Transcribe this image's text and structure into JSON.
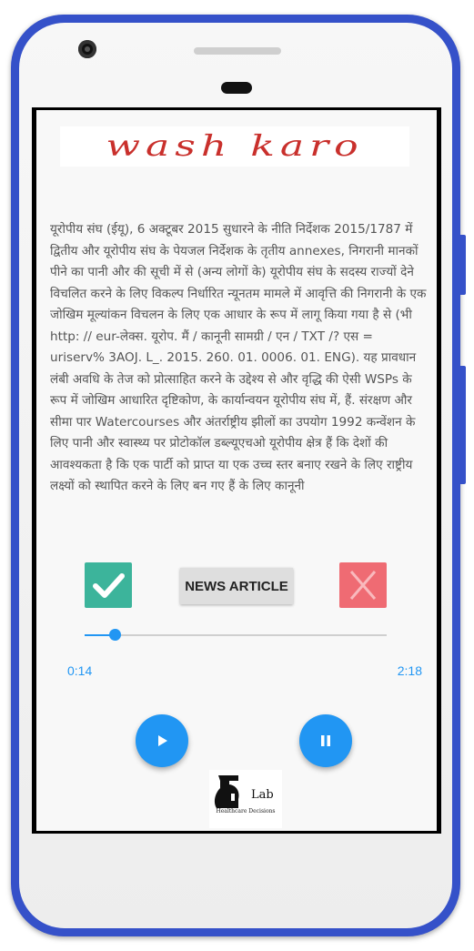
{
  "app": {
    "logo_text": "wash karo"
  },
  "article": {
    "text": "यूरोपीय संघ (ईयू), 6 अक्टूबर 2015 सुधारने के नीति निर्देशक 2015/1787 में द्वितीय और यूरोपीय संघ के पेयजल निर्देशक के तृतीय annexes, निगरानी मानकों पीने का पानी और की सूची में से (अन्य लोगों के) यूरोपीय संघ के सदस्य राज्यों देने विचलित करने के लिए विकल्प निर्धारित न्यूनतम मामले में आवृत्ति की निगरानी के एक जोखिम मूल्यांकन विचलन के लिए एक आधार के रूप में लागू किया गया है से (भी http: // eur-लेक्स. यूरोप. मैं / कानूनी सामग्री / एन / TXT /? एस = uriserv% 3AOJ. L_. 2015. 260. 01. 0006. 01. ENG). यह प्रावधान लंबी अवधि के तेज को प्रोत्साहित करने के उद्देश्य से और वृद्धि की ऐसी WSPs के रूप में जोखिम आधारित दृष्टिकोण, के कार्यान्वयन यूरोपीय संघ में, हैं. संरक्षण और सीमा पार Watercourses और अंतर्राष्ट्रीय झीलों का उपयोग 1992 कन्वेंशन के लिए पानी और स्वास्थ्य पर प्रोटोकॉल डब्ल्यूएचओ यूरोपीय क्षेत्र हैं कि देशों की आवश्यकता है कि एक पार्टी को प्राप्त या एक उच्च स्तर बनाए रखने के लिए राष्ट्रीय लक्ष्यों को स्थापित करने के लिए बन गए हैं के लिए कानूनी"
  },
  "actions": {
    "confirm_icon": "check-icon",
    "news_label": "NEWS ARTICLE",
    "reject_icon": "close-icon",
    "confirm_color": "#3cb49b",
    "reject_color": "#ef6b73"
  },
  "player": {
    "current_time": "0:14",
    "total_time": "2:18",
    "progress": 0.1,
    "play_icon": "play-icon",
    "pause_icon": "pause-icon",
    "accent_color": "#2196f3"
  },
  "footer": {
    "lab_label": "Lab",
    "lab_subtitle": "Healthcare Decisions"
  }
}
